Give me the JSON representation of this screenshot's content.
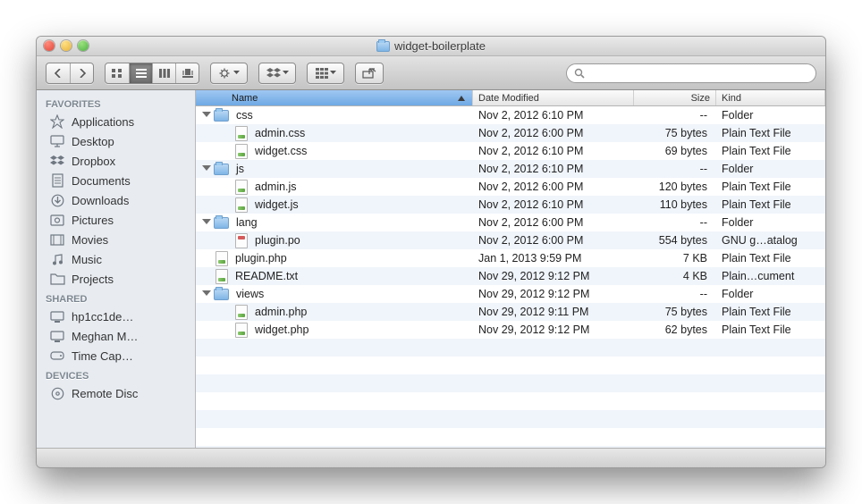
{
  "window_title": "widget-boilerplate",
  "search_placeholder": "",
  "sidebar": {
    "sections": [
      {
        "label": "FAVORITES",
        "items": [
          {
            "label": "Applications",
            "icon": "apps"
          },
          {
            "label": "Desktop",
            "icon": "desktop"
          },
          {
            "label": "Dropbox",
            "icon": "dropbox"
          },
          {
            "label": "Documents",
            "icon": "documents"
          },
          {
            "label": "Downloads",
            "icon": "downloads"
          },
          {
            "label": "Pictures",
            "icon": "pictures"
          },
          {
            "label": "Movies",
            "icon": "movies"
          },
          {
            "label": "Music",
            "icon": "music"
          },
          {
            "label": "Projects",
            "icon": "folder"
          }
        ]
      },
      {
        "label": "SHARED",
        "items": [
          {
            "label": "hp1cc1de…",
            "icon": "display"
          },
          {
            "label": "Meghan M…",
            "icon": "display"
          },
          {
            "label": "Time Cap…",
            "icon": "drive"
          }
        ]
      },
      {
        "label": "DEVICES",
        "items": [
          {
            "label": "Remote Disc",
            "icon": "disc"
          }
        ]
      }
    ]
  },
  "columns": {
    "name": "Name",
    "date": "Date Modified",
    "size": "Size",
    "kind": "Kind"
  },
  "rows": [
    {
      "depth": 0,
      "type": "folder",
      "open": true,
      "name": "css",
      "date": "Nov 2, 2012 6:10 PM",
      "size": "--",
      "kind": "Folder"
    },
    {
      "depth": 1,
      "type": "file",
      "name": "admin.css",
      "date": "Nov 2, 2012 6:00 PM",
      "size": "75 bytes",
      "kind": "Plain Text File"
    },
    {
      "depth": 1,
      "type": "file",
      "name": "widget.css",
      "date": "Nov 2, 2012 6:10 PM",
      "size": "69 bytes",
      "kind": "Plain Text File"
    },
    {
      "depth": 0,
      "type": "folder",
      "open": true,
      "name": "js",
      "date": "Nov 2, 2012 6:10 PM",
      "size": "--",
      "kind": "Folder"
    },
    {
      "depth": 1,
      "type": "file",
      "name": "admin.js",
      "date": "Nov 2, 2012 6:00 PM",
      "size": "120 bytes",
      "kind": "Plain Text File"
    },
    {
      "depth": 1,
      "type": "file",
      "name": "widget.js",
      "date": "Nov 2, 2012 6:10 PM",
      "size": "110 bytes",
      "kind": "Plain Text File"
    },
    {
      "depth": 0,
      "type": "folder",
      "open": true,
      "name": "lang",
      "date": "Nov 2, 2012 6:00 PM",
      "size": "--",
      "kind": "Folder"
    },
    {
      "depth": 1,
      "type": "lang",
      "name": "plugin.po",
      "date": "Nov 2, 2012 6:00 PM",
      "size": "554 bytes",
      "kind": "GNU g…atalog"
    },
    {
      "depth": 0,
      "type": "file",
      "name": "plugin.php",
      "date": "Jan 1, 2013 9:59 PM",
      "size": "7 KB",
      "kind": "Plain Text File"
    },
    {
      "depth": 0,
      "type": "file",
      "name": "README.txt",
      "date": "Nov 29, 2012 9:12 PM",
      "size": "4 KB",
      "kind": "Plain…cument"
    },
    {
      "depth": 0,
      "type": "folder",
      "open": true,
      "name": "views",
      "date": "Nov 29, 2012 9:12 PM",
      "size": "--",
      "kind": "Folder"
    },
    {
      "depth": 1,
      "type": "file",
      "name": "admin.php",
      "date": "Nov 29, 2012 9:11 PM",
      "size": "75 bytes",
      "kind": "Plain Text File"
    },
    {
      "depth": 1,
      "type": "file",
      "name": "widget.php",
      "date": "Nov 29, 2012 9:12 PM",
      "size": "62 bytes",
      "kind": "Plain Text File"
    }
  ],
  "empty_rows": 7
}
